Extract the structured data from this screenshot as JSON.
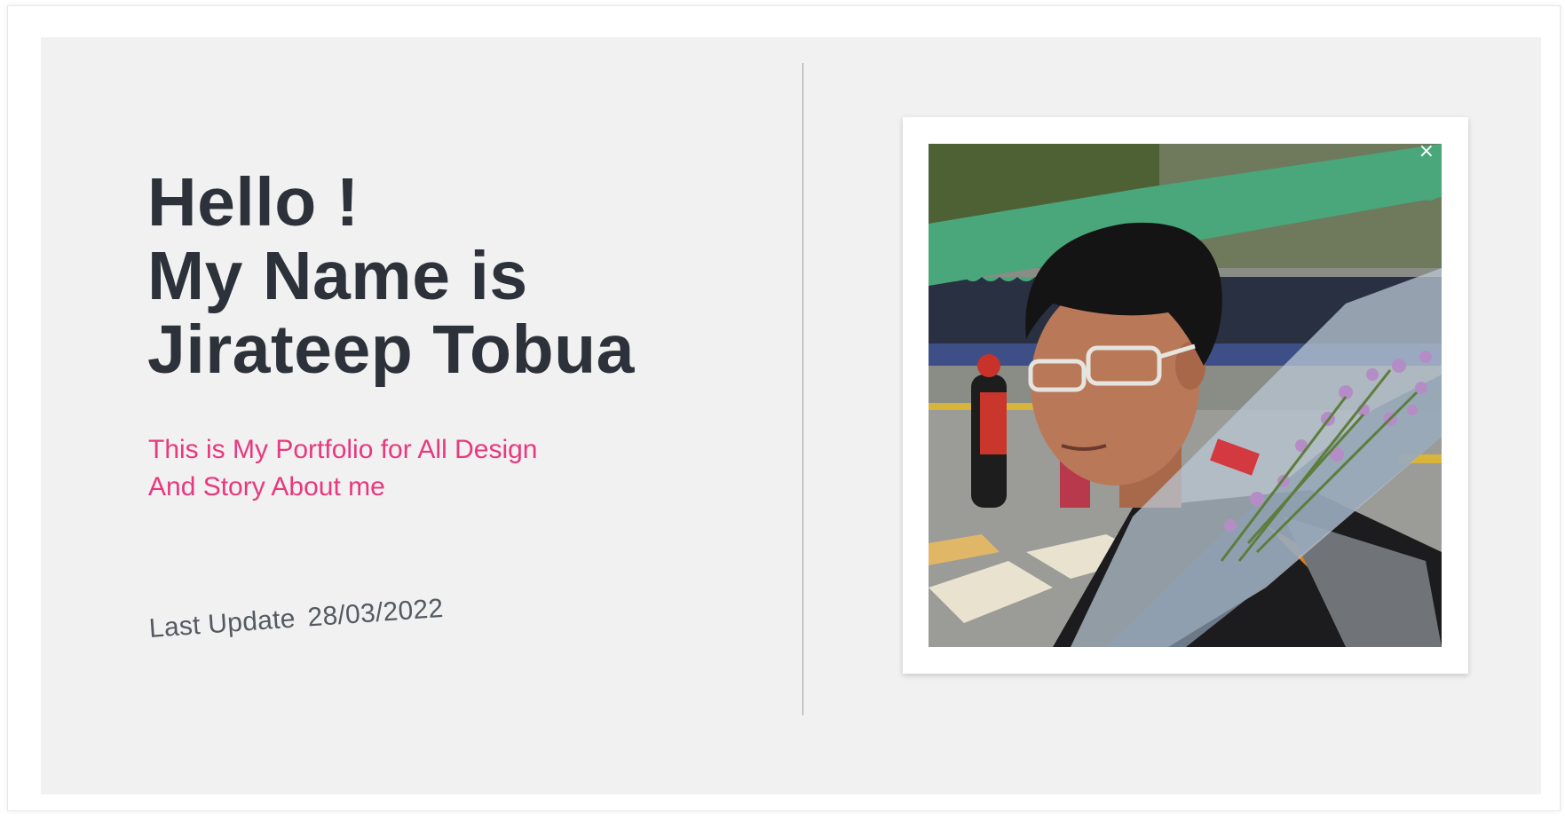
{
  "hero": {
    "heading_line1": "Hello !",
    "heading_line2": "My Name is",
    "heading_line3": "Jirateep Tobua",
    "subtitle_line1": "This is My Portfolio for All Design",
    "subtitle_line2": "And Story About me",
    "update_label": "Last Update",
    "update_date": "28/03/2022"
  },
  "photo": {
    "close_glyph": "×",
    "close_icon": "close-icon"
  },
  "colors": {
    "panel_bg": "#f1f1f1",
    "heading": "#2d3139",
    "accent": "#e8387f",
    "update_text": "#555a62",
    "divider": "#9e9e9e"
  }
}
